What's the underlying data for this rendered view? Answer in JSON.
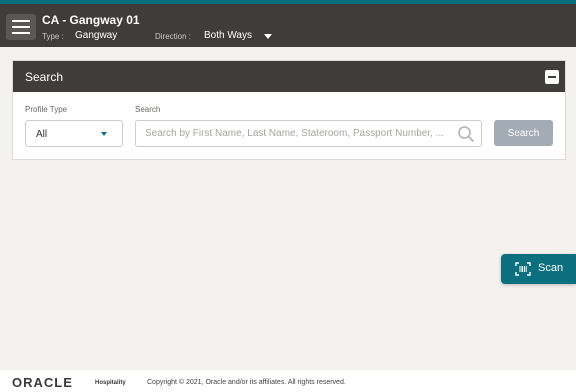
{
  "header": {
    "title": "CA - Gangway 01",
    "type_label": "Type :",
    "type_value": "Gangway",
    "direction_label": "Direction :",
    "direction_value": "Both Ways"
  },
  "search_panel": {
    "title": "Search",
    "profile_type_label": "Profile Type",
    "profile_type_value": "All",
    "search_label": "Search",
    "search_placeholder": "Search by First Name, Last Name, Stateroom, Passport Number, ...",
    "search_value": "",
    "search_button": "Search"
  },
  "scan_button": {
    "label": "Scan"
  },
  "footer": {
    "logo_text": "ORACLE",
    "logo_sub": "Hospitality",
    "copyright": "Copyright © 2021, Oracle and/or its affiliates. All rights reserved."
  },
  "colors": {
    "header_bg": "#3f3d3a",
    "accent": "#0c6f7e",
    "search_button_bg": "#a3acb4",
    "page_bg": "#f3f2ef"
  },
  "icons": [
    "menu-icon",
    "chevron-down-icon",
    "collapse-icon",
    "search-icon",
    "barcode-scan-icon"
  ]
}
